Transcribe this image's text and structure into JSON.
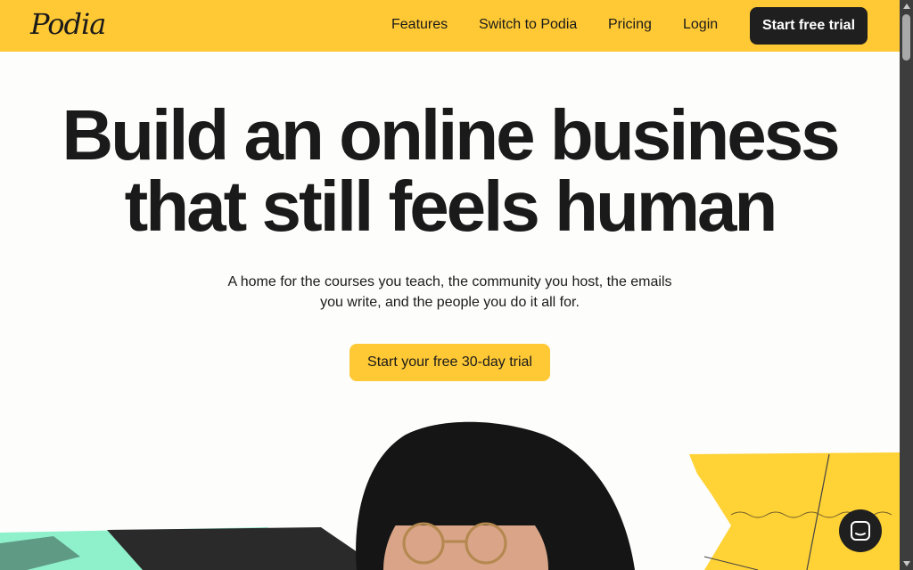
{
  "header": {
    "logo_text": "Podia",
    "nav": {
      "features": "Features",
      "switch": "Switch to Podia",
      "pricing": "Pricing",
      "login": "Login"
    },
    "trial_button": "Start free trial"
  },
  "hero": {
    "title_line1": "Build an online business",
    "title_line2": "that still feels human",
    "subtitle_line1": "A home for the courses you teach, the community you host, the emails",
    "subtitle_line2": "you write, and the people you do it all for.",
    "cta": "Start your free 30-day trial"
  },
  "colors": {
    "brand_yellow": "#ffc935",
    "dark": "#1f1f1f",
    "background": "#fdfdfb"
  },
  "icons": {
    "chat": "chat-bubble-icon"
  }
}
